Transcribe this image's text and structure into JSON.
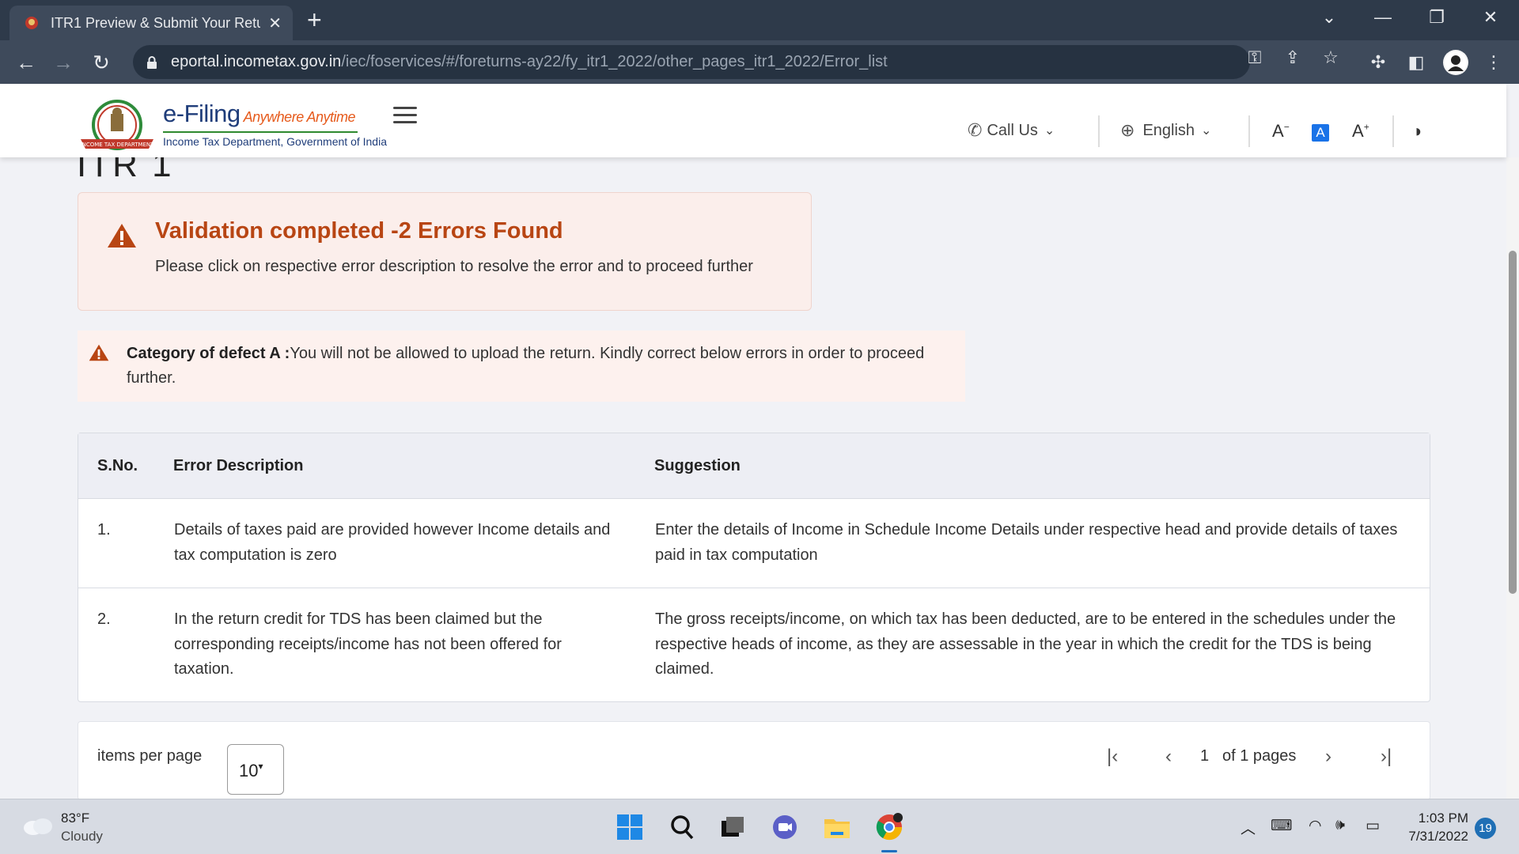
{
  "browser": {
    "tab_title": "ITR1 Preview & Submit Your Retu",
    "url_host": "eportal.incometax.gov.in",
    "url_path": "/iec/foservices/#/foreturns-ay22/fy_itr1_2022/other_pages_itr1_2022/Error_list"
  },
  "header": {
    "logo_title": "e-Filing",
    "logo_tagline": "Anywhere Anytime",
    "logo_subtitle": "Income Tax Department, Government of India",
    "call_us": "Call Us",
    "language": "English",
    "font_decrease": "A",
    "font_normal": "A",
    "font_increase": "A"
  },
  "page": {
    "heading": "ITR 1",
    "summary_title": "Validation completed -2  Errors Found",
    "summary_subtitle": "Please click on respective error description to resolve the error and to proceed further",
    "defect_label": "Category of defect A :",
    "defect_text": "You will not be allowed to upload the return. Kindly correct below errors in order to proceed further."
  },
  "table": {
    "headers": [
      "S.No.",
      "Error Description",
      "Suggestion"
    ],
    "rows": [
      {
        "sno": "1.",
        "description": "Details of taxes paid are provided however Income details and tax computation is zero",
        "suggestion": "Enter the details of Income in Schedule Income Details under respective head and provide details of taxes paid in tax computation"
      },
      {
        "sno": "2.",
        "description": "In the return credit for TDS has been claimed but the corresponding receipts/income has not been offered for taxation.",
        "suggestion": "The gross receipts/income, on which tax has been deducted, are to be entered in the schedules under the respective heads of income, as they are assessable in the year in which the credit for the TDS is being claimed."
      }
    ]
  },
  "pager": {
    "items_per_page_label": "items per page",
    "items_per_page_value": "10",
    "current_page": "1",
    "page_suffix": "of 1 pages"
  },
  "taskbar": {
    "temperature": "83°F",
    "weather": "Cloudy",
    "time": "1:03 PM",
    "date": "7/31/2022",
    "notifications": "19"
  },
  "colors": {
    "error_accent": "#b84513",
    "error_bg": "#fbeeeb",
    "brand_blue": "#1f3d7a",
    "active_blue": "#1a73e8"
  }
}
